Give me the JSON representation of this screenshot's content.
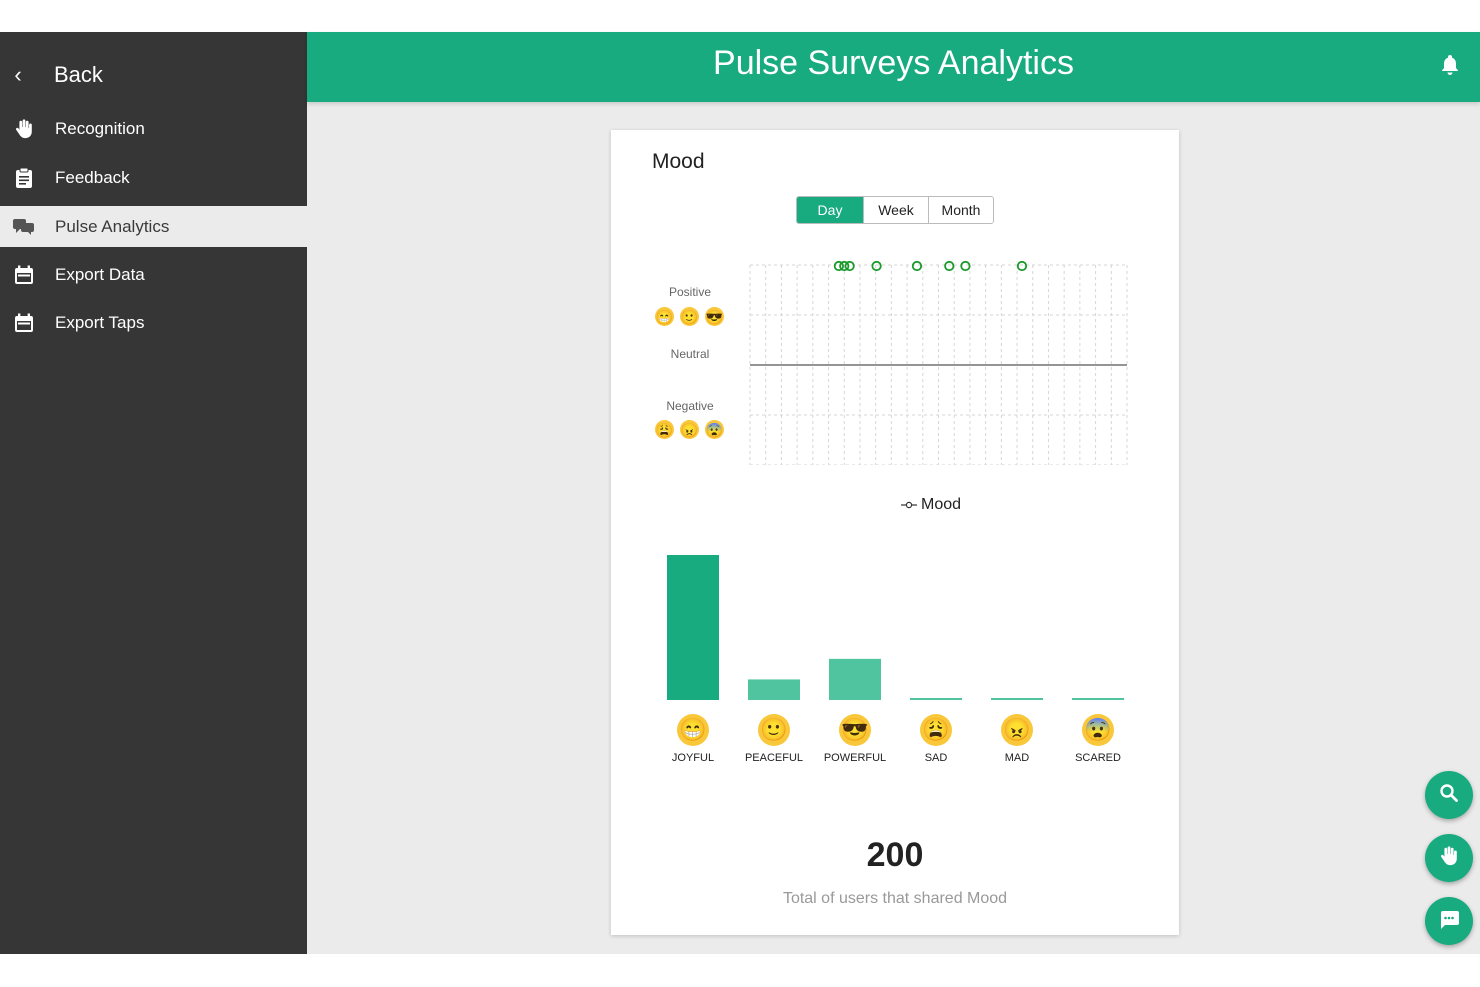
{
  "app": {
    "title": "Pulse Surveys Analytics"
  },
  "sidebar": {
    "back_label": "Back",
    "items": [
      {
        "label": "Recognition",
        "icon": "hand-icon",
        "active": false
      },
      {
        "label": "Feedback",
        "icon": "clipboard-icon",
        "active": false
      },
      {
        "label": "Pulse Analytics",
        "icon": "chat-bubbles-icon",
        "active": true
      },
      {
        "label": "Export Data",
        "icon": "calendar-icon",
        "active": false
      },
      {
        "label": "Export Taps",
        "icon": "calendar-icon",
        "active": false
      }
    ]
  },
  "card": {
    "title": "Mood",
    "tabs": [
      "Day",
      "Week",
      "Month"
    ],
    "selected_tab": "Day",
    "y_labels": {
      "positive": "Positive",
      "neutral": "Neutral",
      "negative": "Negative"
    },
    "legend": "Mood",
    "total": "200",
    "total_caption": "Total of users that shared Mood"
  },
  "mood_timeline": {
    "point_level": "positive",
    "point_count": 8,
    "color": "#1a9a2a"
  },
  "chart_data": {
    "type": "bar",
    "categories": [
      "JOYFUL",
      "PEACEFUL",
      "POWERFUL",
      "SAD",
      "MAD",
      "SCARED"
    ],
    "values": [
      148,
      21,
      42,
      2,
      2,
      2
    ],
    "emojis": [
      "😁",
      "🙂",
      "😎",
      "😩",
      "😠",
      "😨"
    ],
    "colors": [
      "#18ab7f",
      "#4fc49f",
      "#4fc49f",
      "#4fc49f",
      "#4fc49f",
      "#4fc49f"
    ]
  },
  "colors": {
    "accent": "#18ab7f",
    "sidebar": "#363636",
    "background": "#ebebeb"
  },
  "fabs": [
    {
      "icon": "search-icon"
    },
    {
      "icon": "hand-icon"
    },
    {
      "icon": "chat-icon"
    }
  ]
}
